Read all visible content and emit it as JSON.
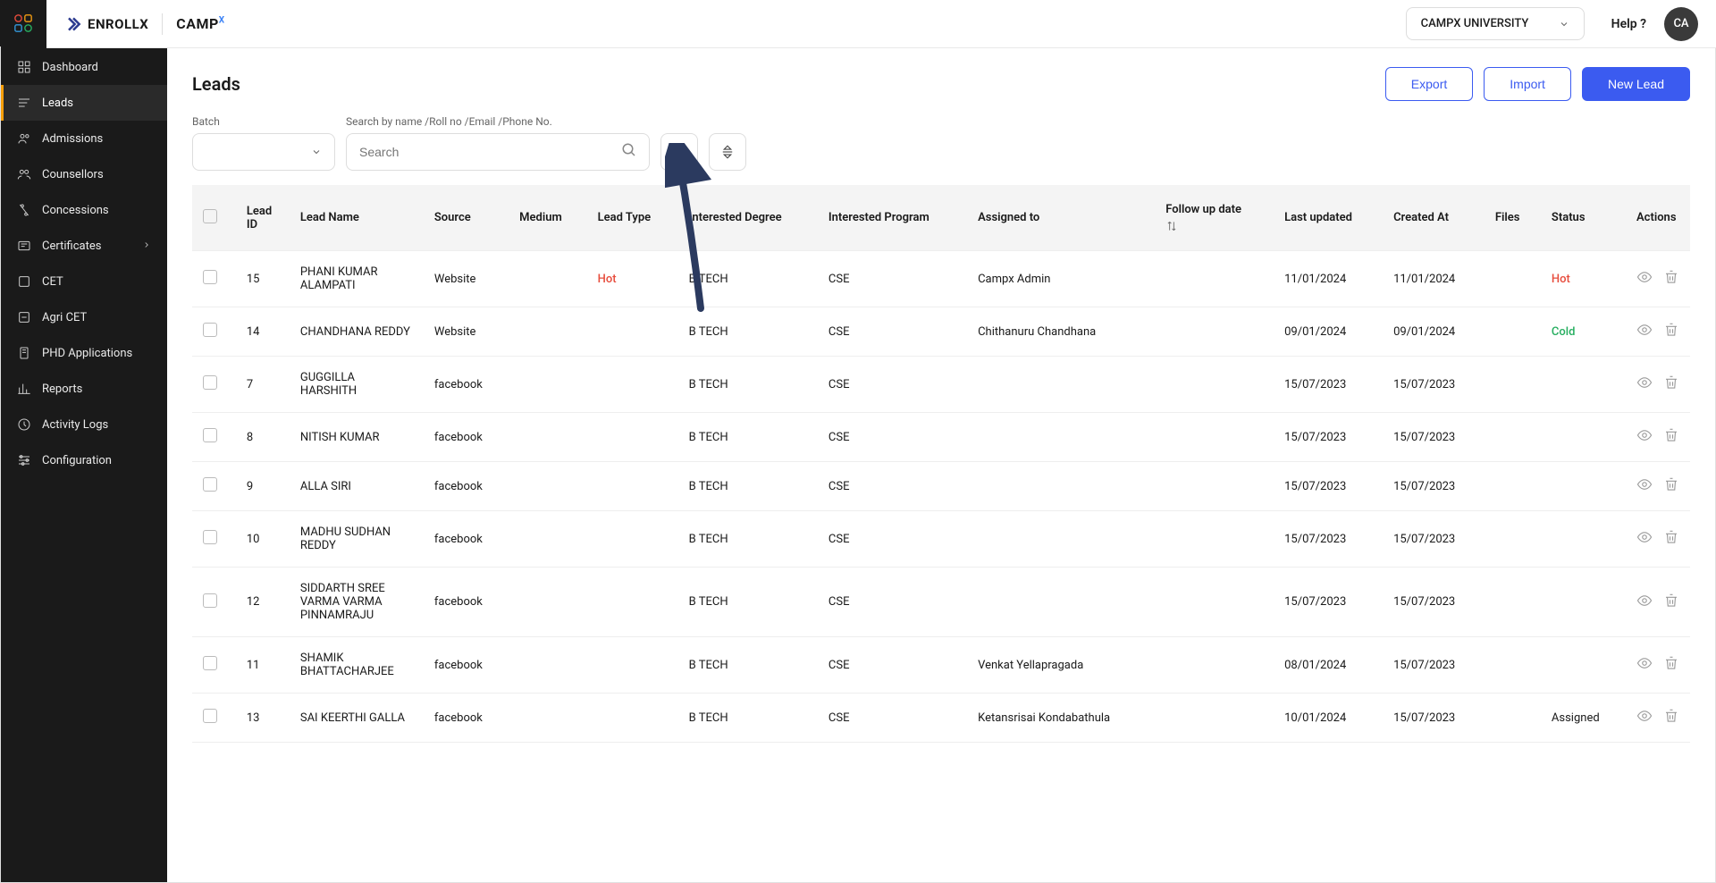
{
  "header": {
    "brand1": "ENROLLX",
    "brand2_a": "CAMP",
    "brand2_b": "X",
    "university": "CAMPX UNIVERSITY",
    "help": "Help ?",
    "avatar": "CA"
  },
  "sidebar": {
    "items": [
      {
        "label": "Dashboard",
        "icon": "dashboard"
      },
      {
        "label": "Leads",
        "icon": "leads",
        "active": true
      },
      {
        "label": "Admissions",
        "icon": "admissions"
      },
      {
        "label": "Counsellors",
        "icon": "counsellors"
      },
      {
        "label": "Concessions",
        "icon": "concessions"
      },
      {
        "label": "Certificates",
        "icon": "certificates",
        "chevron": true
      },
      {
        "label": "CET",
        "icon": "cet"
      },
      {
        "label": "Agri CET",
        "icon": "agri"
      },
      {
        "label": "PHD Applications",
        "icon": "phd"
      },
      {
        "label": "Reports",
        "icon": "reports"
      },
      {
        "label": "Activity Logs",
        "icon": "activity"
      },
      {
        "label": "Configuration",
        "icon": "config"
      }
    ]
  },
  "page": {
    "title": "Leads",
    "export": "Export",
    "import": "Import",
    "new_lead": "New Lead"
  },
  "filters": {
    "batch_label": "Batch",
    "search_label": "Search by name /Roll no /Email /Phone No.",
    "search_placeholder": "Search"
  },
  "table": {
    "columns": [
      "Lead ID",
      "Lead Name",
      "Source",
      "Medium",
      "Lead Type",
      "Interested Degree",
      "Interested Program",
      "Assigned to",
      "Follow up date",
      "Last updated",
      "Created At",
      "Files",
      "Status",
      "Actions"
    ],
    "rows": [
      {
        "id": "15",
        "name": "PHANI KUMAR ALAMPATI",
        "source": "Website",
        "medium": "",
        "type": "Hot",
        "type_class": "status-hot",
        "degree": "B TECH",
        "program": "CSE",
        "assigned": "Campx Admin",
        "followup": "",
        "updated": "11/01/2024",
        "created": "11/01/2024",
        "files": "",
        "status": "Hot",
        "status_class": "status-hot"
      },
      {
        "id": "14",
        "name": "CHANDHANA REDDY",
        "source": "Website",
        "medium": "",
        "type": "",
        "type_class": "",
        "degree": "B TECH",
        "program": "CSE",
        "assigned": "Chithanuru Chandhana",
        "followup": "",
        "updated": "09/01/2024",
        "created": "09/01/2024",
        "files": "",
        "status": "Cold",
        "status_class": "status-cold"
      },
      {
        "id": "7",
        "name": "GUGGILLA HARSHITH",
        "source": "facebook",
        "medium": "",
        "type": "",
        "type_class": "",
        "degree": "B TECH",
        "program": "CSE",
        "assigned": "",
        "followup": "",
        "updated": "15/07/2023",
        "created": "15/07/2023",
        "files": "",
        "status": "",
        "status_class": ""
      },
      {
        "id": "8",
        "name": "NITISH KUMAR",
        "source": "facebook",
        "medium": "",
        "type": "",
        "type_class": "",
        "degree": "B TECH",
        "program": "CSE",
        "assigned": "",
        "followup": "",
        "updated": "15/07/2023",
        "created": "15/07/2023",
        "files": "",
        "status": "",
        "status_class": ""
      },
      {
        "id": "9",
        "name": "ALLA SIRI",
        "source": "facebook",
        "medium": "",
        "type": "",
        "type_class": "",
        "degree": "B TECH",
        "program": "CSE",
        "assigned": "",
        "followup": "",
        "updated": "15/07/2023",
        "created": "15/07/2023",
        "files": "",
        "status": "",
        "status_class": ""
      },
      {
        "id": "10",
        "name": "MADHU SUDHAN REDDY",
        "source": "facebook",
        "medium": "",
        "type": "",
        "type_class": "",
        "degree": "B TECH",
        "program": "CSE",
        "assigned": "",
        "followup": "",
        "updated": "15/07/2023",
        "created": "15/07/2023",
        "files": "",
        "status": "",
        "status_class": ""
      },
      {
        "id": "12",
        "name": "SIDDARTH SREE VARMA VARMA PINNAMRAJU",
        "source": "facebook",
        "medium": "",
        "type": "",
        "type_class": "",
        "degree": "B TECH",
        "program": "CSE",
        "assigned": "",
        "followup": "",
        "updated": "15/07/2023",
        "created": "15/07/2023",
        "files": "",
        "status": "",
        "status_class": ""
      },
      {
        "id": "11",
        "name": "SHAMIK BHATTACHARJEE",
        "source": "facebook",
        "medium": "",
        "type": "",
        "type_class": "",
        "degree": "B TECH",
        "program": "CSE",
        "assigned": "Venkat Yellapragada",
        "followup": "",
        "updated": "08/01/2024",
        "created": "15/07/2023",
        "files": "",
        "status": "",
        "status_class": ""
      },
      {
        "id": "13",
        "name": "SAI KEERTHI GALLA",
        "source": "facebook",
        "medium": "",
        "type": "",
        "type_class": "",
        "degree": "B TECH",
        "program": "CSE",
        "assigned": "Ketansrisai Kondabathula",
        "followup": "",
        "updated": "10/01/2024",
        "created": "15/07/2023",
        "files": "",
        "status": "Assigned",
        "status_class": ""
      }
    ]
  }
}
